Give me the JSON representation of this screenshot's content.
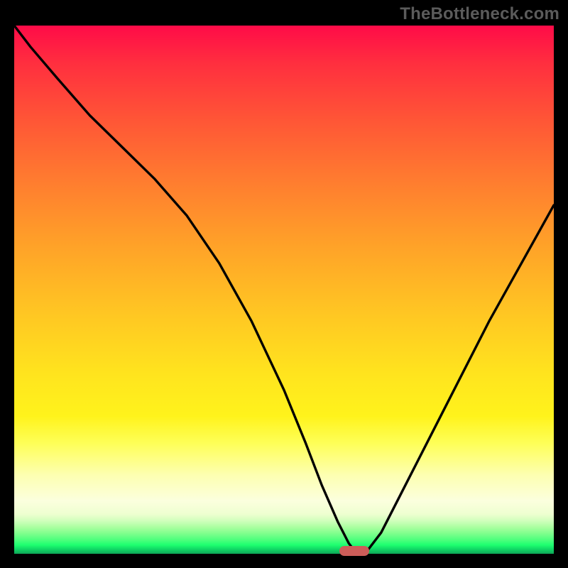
{
  "watermark": "TheBottleneck.com",
  "colors": {
    "frame": "#000000",
    "watermark_text": "#5b5b5b",
    "curve": "#000000",
    "marker": "#cc5d59",
    "gradient_top": "#ff0b48",
    "gradient_mid": "#ffe41e",
    "gradient_bottom": "#0ea557"
  },
  "chart_data": {
    "type": "line",
    "title": "",
    "xlabel": "",
    "ylabel": "",
    "xlim": [
      0,
      100
    ],
    "ylim": [
      0,
      100
    ],
    "grid": false,
    "legend": false,
    "series": [
      {
        "name": "bottleneck-curve",
        "x": [
          0,
          3,
          8,
          14,
          20,
          26,
          32,
          38,
          44,
          50,
          54,
          57,
          60,
          62,
          63.5,
          65,
          68,
          72,
          76,
          82,
          88,
          94,
          100
        ],
        "y": [
          100,
          96,
          90,
          83,
          77,
          71,
          64,
          55,
          44,
          31,
          21,
          13,
          6,
          2,
          0,
          0,
          4,
          12,
          20,
          32,
          44,
          55,
          66
        ]
      }
    ],
    "marker": {
      "x": 63,
      "y": 0,
      "shape": "pill",
      "color": "#cc5d59"
    }
  }
}
